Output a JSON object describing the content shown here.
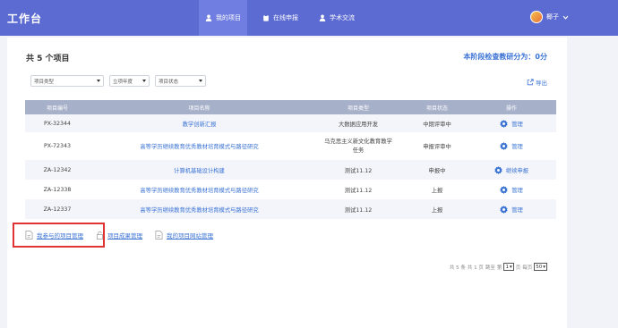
{
  "header": {
    "brand": "工作台",
    "nav": [
      {
        "label": "我的项目",
        "icon": "user-icon"
      },
      {
        "label": "在线申报",
        "icon": "clipboard-icon"
      },
      {
        "label": "学术交流",
        "icon": "user-icon"
      }
    ],
    "user_name": "椰子"
  },
  "main": {
    "title": "共 5 个项目",
    "score_text": "本阶段检查教研分为：0分",
    "filters": [
      "项目类型",
      "立项年度",
      "项目状态"
    ],
    "export_label": "导出"
  },
  "table": {
    "columns": [
      "项目编号",
      "项目名称",
      "项目类型",
      "项目状态",
      "操作"
    ],
    "rows": [
      {
        "id": "PX-32344",
        "name": "教学创新汇报",
        "type": "大数据应用开发",
        "status": "中期评审中",
        "action": "管理"
      },
      {
        "id": "PX-72343",
        "name": "高等学历继续教育优秀教材培育模式与路径研究",
        "type": "马克思主义新文化教育教学任务",
        "status": "申报评审中",
        "action": "管理"
      },
      {
        "id": "ZA-12342",
        "name": "计算机基础设计构建",
        "type": "测试11.12",
        "status": "申报中",
        "action": "继续申报"
      },
      {
        "id": "ZA-12338",
        "name": "高等学历继续教育优秀教材培育模式与路径研究",
        "type": "测试11.12",
        "status": "上报",
        "action": "管理"
      },
      {
        "id": "ZA-12337",
        "name": "高等学历继续教育优秀教材培育模式与路径研究",
        "type": "测试11.12",
        "status": "上报",
        "action": "管理"
      }
    ]
  },
  "bottom_links": [
    "我参与的项目管理",
    "项目成果管理",
    "我的项目网站管理"
  ],
  "pager": {
    "total": "共 5 条",
    "pages": "共 1 页",
    "jump": "跳至",
    "page_prefix": "第",
    "page_value": "1",
    "page_suffix": "页",
    "per_page": "每页",
    "per_page_value": "50"
  },
  "colors": {
    "header_bg": "#5b6bd1",
    "accent": "#3b73d4",
    "highlight": "#e03434"
  }
}
